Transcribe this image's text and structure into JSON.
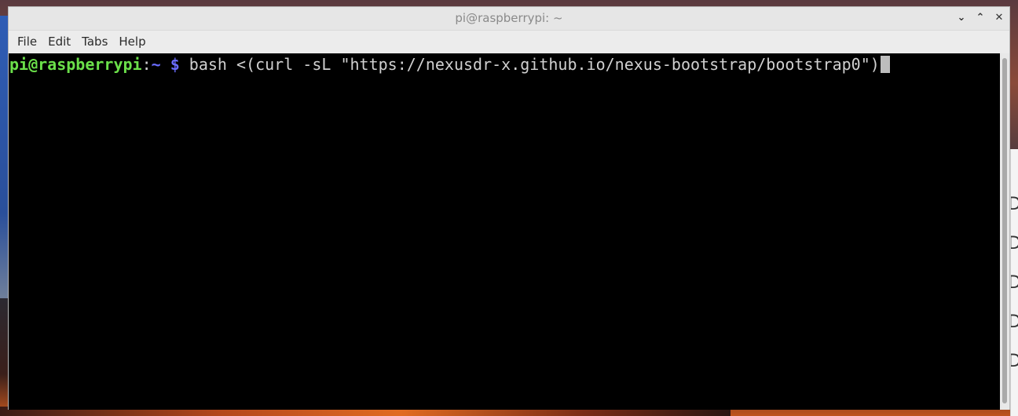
{
  "window": {
    "title": "pi@raspberrypi: ~",
    "buttons": {
      "minimize": "⌄",
      "maximize": "⌃",
      "close": "✕"
    }
  },
  "menu": {
    "items": [
      "File",
      "Edit",
      "Tabs",
      "Help"
    ]
  },
  "terminal": {
    "prompt_user": "pi@raspberrypi",
    "prompt_sep": ":",
    "prompt_path": "~",
    "prompt_dollar": "$",
    "command": " bash <(curl -sL \"https://nexusdr-x.github.io/nexus-bootstrap/bootstrap0\")"
  },
  "desktop": {
    "peek_text": [
      "De",
      "De",
      "De",
      "De",
      "De"
    ]
  },
  "colors": {
    "prompt_user": "#6be04a",
    "prompt_path": "#6a6cff",
    "terminal_bg": "#000000",
    "terminal_fg": "#d0d0d0"
  }
}
